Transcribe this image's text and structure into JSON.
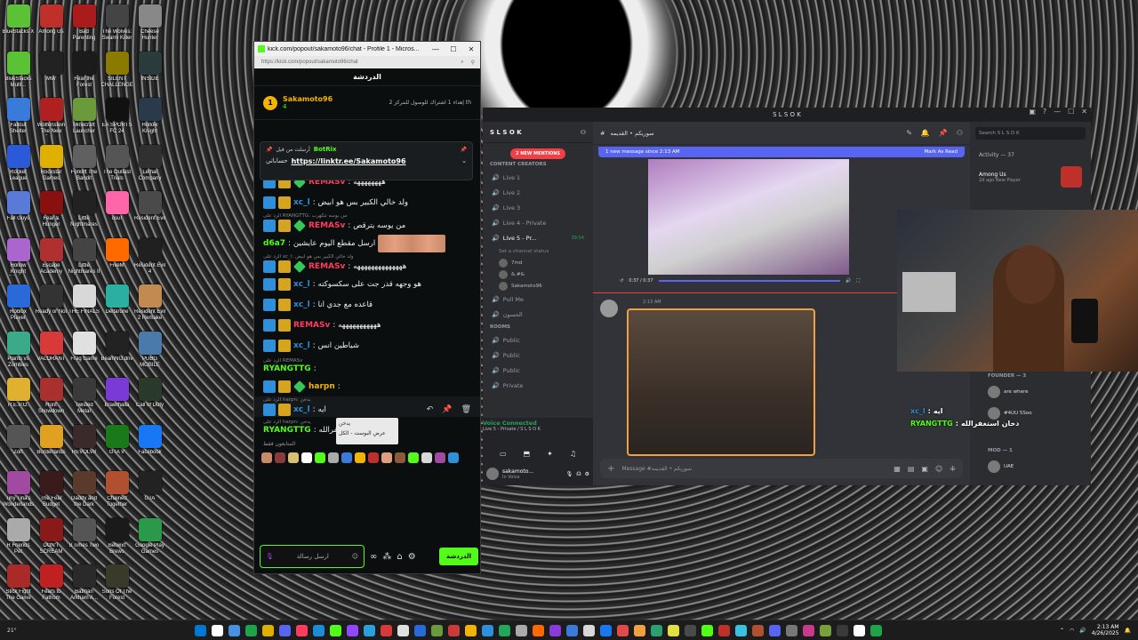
{
  "desktop": {
    "icons": [
      {
        "label": "BlueStacks X",
        "color": "#5bc236"
      },
      {
        "label": "Among Us",
        "color": "#c0302b"
      },
      {
        "label": "Bad Parenting",
        "color": "#aa1c1c"
      },
      {
        "label": "The Wolves: Swarm Killer",
        "color": "#444444"
      },
      {
        "label": "Cheese Hunter",
        "color": "#888888"
      },
      {
        "label": "BlueStacks Multi...",
        "color": "#5bc236"
      },
      {
        "label": "MW",
        "color": "#222222"
      },
      {
        "label": "Fear the Forest",
        "color": "#1b1b1b"
      },
      {
        "label": "SILENT CHALLENGE",
        "color": "#8a7a00"
      },
      {
        "label": "INSIDE",
        "color": "#2b3a3a"
      },
      {
        "label": "Fallout Shelter",
        "color": "#3a7ad8"
      },
      {
        "label": "Wolfenstein The New Order",
        "color": "#b02020"
      },
      {
        "label": "Minecraft Launcher",
        "color": "#6a9a3a"
      },
      {
        "label": "EA SPORTS FC 24",
        "color": "#111111"
      },
      {
        "label": "Hollow Knight",
        "color": "#2b3a4a"
      },
      {
        "label": "Rocket League",
        "color": "#2a5ad8"
      },
      {
        "label": "Rockstar Games Launcher",
        "color": "#e0b000"
      },
      {
        "label": "Forklift The Bandit",
        "color": "#606060"
      },
      {
        "label": "The Outlast Trials",
        "color": "#555555"
      },
      {
        "label": "Lethal Company",
        "color": "#303030"
      },
      {
        "label": "Fall Guys",
        "color": "#5a7ad8"
      },
      {
        "label": "Fear & Hunger",
        "color": "#8a1010"
      },
      {
        "label": "Little Nightmares",
        "color": "#222222"
      },
      {
        "label": "osu!",
        "color": "#ff66aa"
      },
      {
        "label": "Resident Evil",
        "color": "#4a4a4a"
      },
      {
        "label": "Hollow Knight Silksong",
        "color": "#aa66cc"
      },
      {
        "label": "Escape Academy",
        "color": "#b03030"
      },
      {
        "label": "Little Nightmares II",
        "color": "#444444"
      },
      {
        "label": "FiveM",
        "color": "#ff6a00"
      },
      {
        "label": "Resident Evil 4",
        "color": "#202020"
      },
      {
        "label": "Roblox Player",
        "color": "#2a6ad8"
      },
      {
        "label": "Ready or Not",
        "color": "#333333"
      },
      {
        "label": "THE FINALS",
        "color": "#d8d8d8"
      },
      {
        "label": "Deltarune",
        "color": "#2ab0a0"
      },
      {
        "label": "Resident Evil 2 Remake",
        "color": "#c08a50"
      },
      {
        "label": "Plants vs Zombies",
        "color": "#3aaa8a"
      },
      {
        "label": "VALORANT",
        "color": "#d83a3a"
      },
      {
        "label": "Frag Game",
        "color": "#e0e0e0"
      },
      {
        "label": "BeamNG.drive",
        "color": "#222222"
      },
      {
        "label": "PUBG MOBILE",
        "color": "#4a7aaa"
      },
      {
        "label": "R.E.P.O.",
        "color": "#e0b030"
      },
      {
        "label": "Hunt Showdown",
        "color": "#aa3030"
      },
      {
        "label": "Twisted Metal",
        "color": "#3a3a3a"
      },
      {
        "label": "Brawlhalla",
        "color": "#7a3ad8"
      },
      {
        "label": "Call of Duty",
        "color": "#2a3a2a"
      },
      {
        "label": "Zort",
        "color": "#555555"
      },
      {
        "label": "Borderlands",
        "color": "#e0a020"
      },
      {
        "label": "REVOLV8",
        "color": "#3a2a2a"
      },
      {
        "label": "GTA V",
        "color": "#1a7a1a"
      },
      {
        "label": "Facebook",
        "color": "#1877f2"
      },
      {
        "label": "Tiny Tina's Wonderlands",
        "color": "#a04aa0"
      },
      {
        "label": "The Fear Budget",
        "color": "#3a1a1a"
      },
      {
        "label": "Daddy and the Dark",
        "color": "#5a3a2a"
      },
      {
        "label": "Chained Together",
        "color": "#b05030"
      },
      {
        "label": "GTA",
        "color": "#222222"
      },
      {
        "label": "R Friends Pet",
        "color": "#aaaaaa"
      },
      {
        "label": "DON'T SCREAM",
        "color": "#8a1a1a"
      },
      {
        "label": "8 Times Two",
        "color": "#555555"
      },
      {
        "label": "Betwixt Brews",
        "color": "#1a1a1a"
      },
      {
        "label": "Google Play Games",
        "color": "#2a9a4a"
      },
      {
        "label": "Stick Fight The Game",
        "color": "#aa2a2a"
      },
      {
        "label": "Fears to Fathom",
        "color": "#c02020"
      },
      {
        "label": "Batman Arkham A...",
        "color": "#2a2a2a"
      },
      {
        "label": "Sons Of The Forest",
        "color": "#3a3a2a"
      }
    ]
  },
  "kick": {
    "window_title": "kick.com/popout/sakamoto96/chat - Profile 1 - Micros...",
    "url": "https://kick.com/popout/sakamoto96/chat",
    "header": "الدردشة",
    "leader": {
      "rank": "1",
      "name": "Sakamoto96",
      "count": "4",
      "info": "2 إهداء 1 اشتراك للوصول للمركز th"
    },
    "pinned": {
      "pinned_by": "أرسلت من قبل",
      "bot_name": "BotRix",
      "text": "حساباتي",
      "link": "https://linktr.ee/Sakamoto96"
    },
    "messages": [
      {
        "reply": "",
        "user": "REMASv",
        "user_color": "#ff3c5c",
        "text": "ههههههههه",
        "badges": [
          "blue",
          "gold",
          "green"
        ]
      },
      {
        "reply": "",
        "user": "xc_l",
        "user_color": "#2f8fd8",
        "text": "ولد خالي الكبير بس هو ابيض",
        "badges": [
          "blue",
          "gold"
        ]
      },
      {
        "reply": "الرد على RYANGTTG: من بوسه تتكهرب",
        "user": "REMASv",
        "user_color": "#ff3c5c",
        "text": "من يوسه يترقص",
        "badges": [
          "blue",
          "gold",
          "green"
        ]
      },
      {
        "reply": "",
        "user": "d6a7",
        "user_color": "#53fc18",
        "text": "ارسل مقطع اليوم عايشين",
        "badges": [],
        "emotes": true
      },
      {
        "reply": "الرد على xc_l: ولد خالي الكبير بس هو ابيض",
        "user": "REMASv",
        "user_color": "#ff3c5c",
        "text": "ههههههههههههههه",
        "badges": [
          "blue",
          "gold",
          "green"
        ]
      },
      {
        "reply": "",
        "user": "xc_l",
        "user_color": "#2f8fd8",
        "text": "هو وجهه قذر جت على سكسوكته",
        "badges": [
          "blue",
          "gold"
        ]
      },
      {
        "reply": "",
        "user": "xc_l",
        "user_color": "#2f8fd8",
        "text": "قاعده مع جدي انا",
        "badges": [
          "blue",
          "gold"
        ]
      },
      {
        "reply": "",
        "user": "REMASv",
        "user_color": "#ff3c5c",
        "text": "هههههههههههه",
        "badges": [
          "blue",
          "gold"
        ]
      },
      {
        "reply": "",
        "user": "xc_l",
        "user_color": "#2f8fd8",
        "text": "شياطين انس",
        "badges": [
          "blue",
          "gold"
        ]
      },
      {
        "reply": "الرد على REMASv",
        "user": "RYANGTTG",
        "user_color": "#53fc18",
        "text": "",
        "badges": []
      },
      {
        "reply": "",
        "user": "harpn",
        "user_color": "#f5b301",
        "text": "",
        "badges": [
          "blue",
          "gold",
          "green"
        ]
      },
      {
        "reply": "الرد على harpn: يدخن",
        "user": "xc_l",
        "user_color": "#2f8fd8",
        "text": "ايه",
        "badges": [
          "blue",
          "gold"
        ],
        "highlight": true
      },
      {
        "reply": "الرد على harpn: يدخن",
        "user": "RYANGTTG",
        "user_color": "#53fc18",
        "text": "دخان استغفرالله",
        "badges": []
      }
    ],
    "tooltip": {
      "title": "يدخن",
      "sub": "عرض البوست - الكل"
    },
    "send_label": "المتابعون فقط",
    "input_placeholder": "ارسل رسالة",
    "chat_button": "الدردشة",
    "emote_colors": [
      "#c98a6a",
      "#8a3a3a",
      "#d8c070",
      "#fff",
      "#53fc18",
      "#aaa",
      "#3a7ad8",
      "#f5b301",
      "#c0302b",
      "#e0a080",
      "#8a5a3a",
      "#53fc18",
      "#d8d8d8",
      "#a04aa0",
      "#2f8fd8"
    ]
  },
  "discord": {
    "title": "S L S O K",
    "server": "S L S O K",
    "new_mentions": "2 NEW MENTIONS",
    "category": "CONTENT CREATORS",
    "channels": [
      {
        "name": "Live 1",
        "active": false
      },
      {
        "name": "Live 2",
        "active": false
      },
      {
        "name": "Live 3",
        "active": false
      },
      {
        "name": "Live 4 - Private",
        "active": false
      },
      {
        "name": "Live 5 - Pr...",
        "active": true,
        "time": "39:54"
      }
    ],
    "channel_status": "Set a channel status",
    "voice_users": [
      "7md",
      "&.#&",
      "Sakamoto96"
    ],
    "extra_channels": [
      "Pull Me",
      "الحسون"
    ],
    "rooms_label": "ROOMS",
    "rooms": [
      "Public",
      "Public",
      "Public",
      "Private"
    ],
    "voice_connected": "Voice Connected",
    "voice_channel": "Live 5 - Private / S L S O K",
    "user_name": "sakamoto...",
    "user_status": "In Voice",
    "topbar_channel": "سوريكم • القديمه",
    "new_message_banner": "1 new message since 2:13 AM",
    "mark_as_read": "Mark As Read",
    "video_time": "0:37 / 0:37",
    "msg_time": "2:13 AM",
    "compose_placeholder": "Message #سوريكم • القديمه",
    "search_placeholder": "Search S L S O K",
    "activity_label": "Activity — 37",
    "activity_user": "Among Us",
    "activity_meta": "2d ago  New Player",
    "founder_label": "FOUNDER — 3",
    "mod_label": "MOD — 1",
    "members": [
      "are where",
      "#4UU 5Soo",
      "UAE"
    ]
  },
  "overlay": [
    {
      "user": "xc_l",
      "text": "ايه",
      "color": "#2f8fd8"
    },
    {
      "user": "RYANGTTG",
      "text": "دخان استغفرالله",
      "color": "#53fc18"
    }
  ],
  "taskbar": {
    "weather": "21°",
    "time": "2:13 AM",
    "date": "4/26/2025",
    "apps": [
      "#0078d4",
      "#ffffff",
      "#4a90e2",
      "#1ea34a",
      "#e0b000",
      "#5865f2",
      "#ff3c5c",
      "#1a8cd8",
      "#53fc18",
      "#9146ff",
      "#2aa1de",
      "#d83a3a",
      "#e0e0e0",
      "#2a6ad8",
      "#6a9a3a",
      "#cc3a3a",
      "#f5b301",
      "#2f8fd8",
      "#23a55a",
      "#aaaaaa",
      "#ff6a00",
      "#8a3ad8",
      "#3a7ad8",
      "#d8d8d8",
      "#1877f2",
      "#e04a4a",
      "#f0a040",
      "#2aa070",
      "#e0e040",
      "#4a4a4a",
      "#53fc18",
      "#c0302b",
      "#3ac0e0",
      "#b05030",
      "#5865f2",
      "#777777",
      "#c83a8a",
      "#7aa03a",
      "#3a3a3a",
      "#ffffff",
      "#1ea34a"
    ]
  }
}
